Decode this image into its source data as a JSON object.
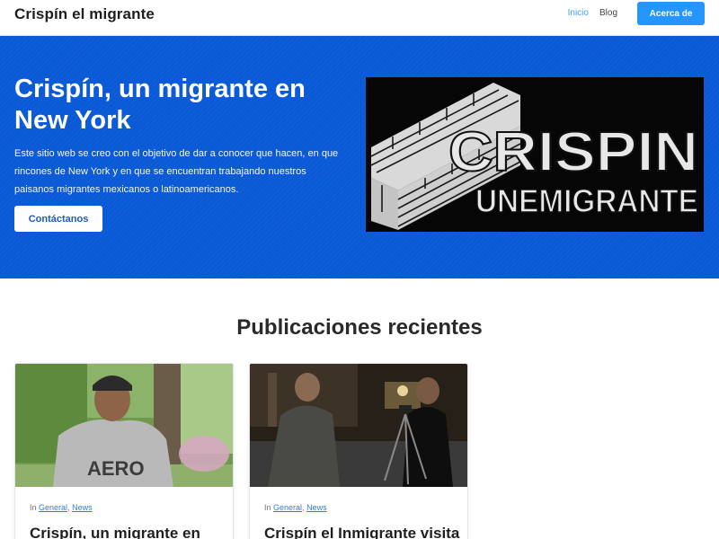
{
  "header": {
    "site_title": "Crispín el migrante",
    "nav": [
      {
        "label": "Inicio",
        "active": true
      },
      {
        "label": "Blog",
        "active": false
      }
    ],
    "cta_label": "Acerca de"
  },
  "hero": {
    "title": "Crispín, un migrante en New York",
    "description": "Este sitio web se creo con el objetivo de dar a conocer que hacen, en que rincones de New York y en que se encuentran trabajando nuestros paisanos migrantes mexicanos o latinoamericanos.",
    "button_label": "Contáctanos",
    "image": {
      "line1": "CRISPIN",
      "line2": "UNEMIGRANTE"
    }
  },
  "recent": {
    "title": "Publicaciones recientes",
    "posts": [
      {
        "prefix": "In",
        "categories": [
          "General",
          "News"
        ],
        "title": "Crispín, un migrante en",
        "shirt_text": "AERO"
      },
      {
        "prefix": "In",
        "categories": [
          "General",
          "News"
        ],
        "title": "Crispín el Inmigrante visita"
      }
    ]
  },
  "colors": {
    "accent": "#2596ff",
    "hero_bg": "#0a59d6",
    "link": "#2f7fe0"
  }
}
